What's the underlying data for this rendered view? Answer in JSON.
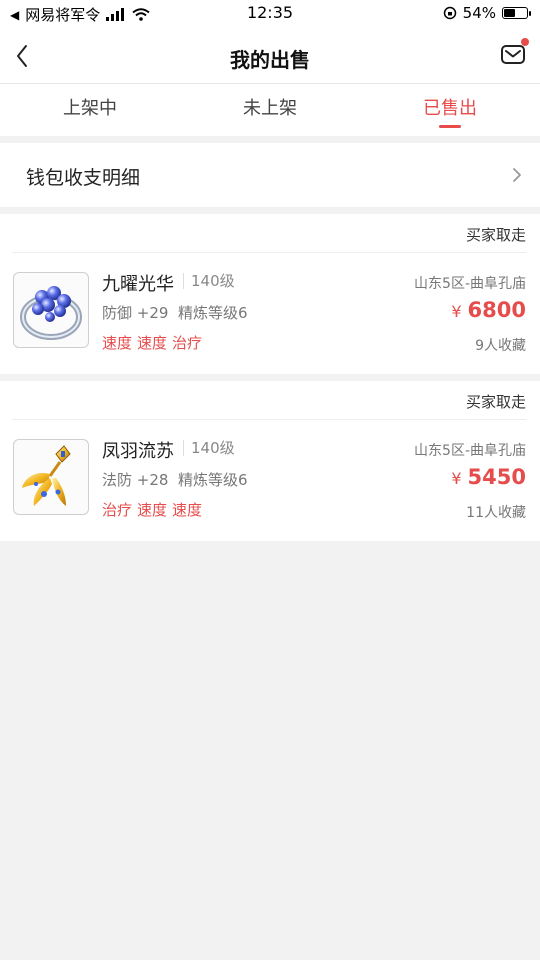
{
  "status_bar": {
    "back_arrow": "◀",
    "carrier": "网易将军令",
    "time": "12:35",
    "battery_percent_text": "54%",
    "battery_level": 0.54
  },
  "nav": {
    "title": "我的出售",
    "back_icon": "chevron-left-icon",
    "mail_icon": "mail-icon"
  },
  "tabs": [
    {
      "label": "上架中",
      "active": false
    },
    {
      "label": "未上架",
      "active": false
    },
    {
      "label": "已售出",
      "active": true
    }
  ],
  "wallet": {
    "label": "钱包收支明细"
  },
  "items": [
    {
      "status": "买家取走",
      "name": "九曜光华",
      "level": "140级",
      "stats": "防御 +29  精炼等级6",
      "tags": [
        "速度",
        "速度",
        "治疗"
      ],
      "server": "山东5区-曲阜孔庙",
      "currency": "¥",
      "price": "6800",
      "favorites": "9人收藏"
    },
    {
      "status": "买家取走",
      "name": "凤羽流苏",
      "level": "140级",
      "stats": "法防 +28  精炼等级6",
      "tags": [
        "治疗",
        "速度",
        "速度"
      ],
      "server": "山东5区-曲阜孔庙",
      "currency": "¥",
      "price": "5450",
      "favorites": "11人收藏"
    }
  ],
  "colors": {
    "accent": "#e74c4c",
    "background": "#f2f2f2"
  }
}
